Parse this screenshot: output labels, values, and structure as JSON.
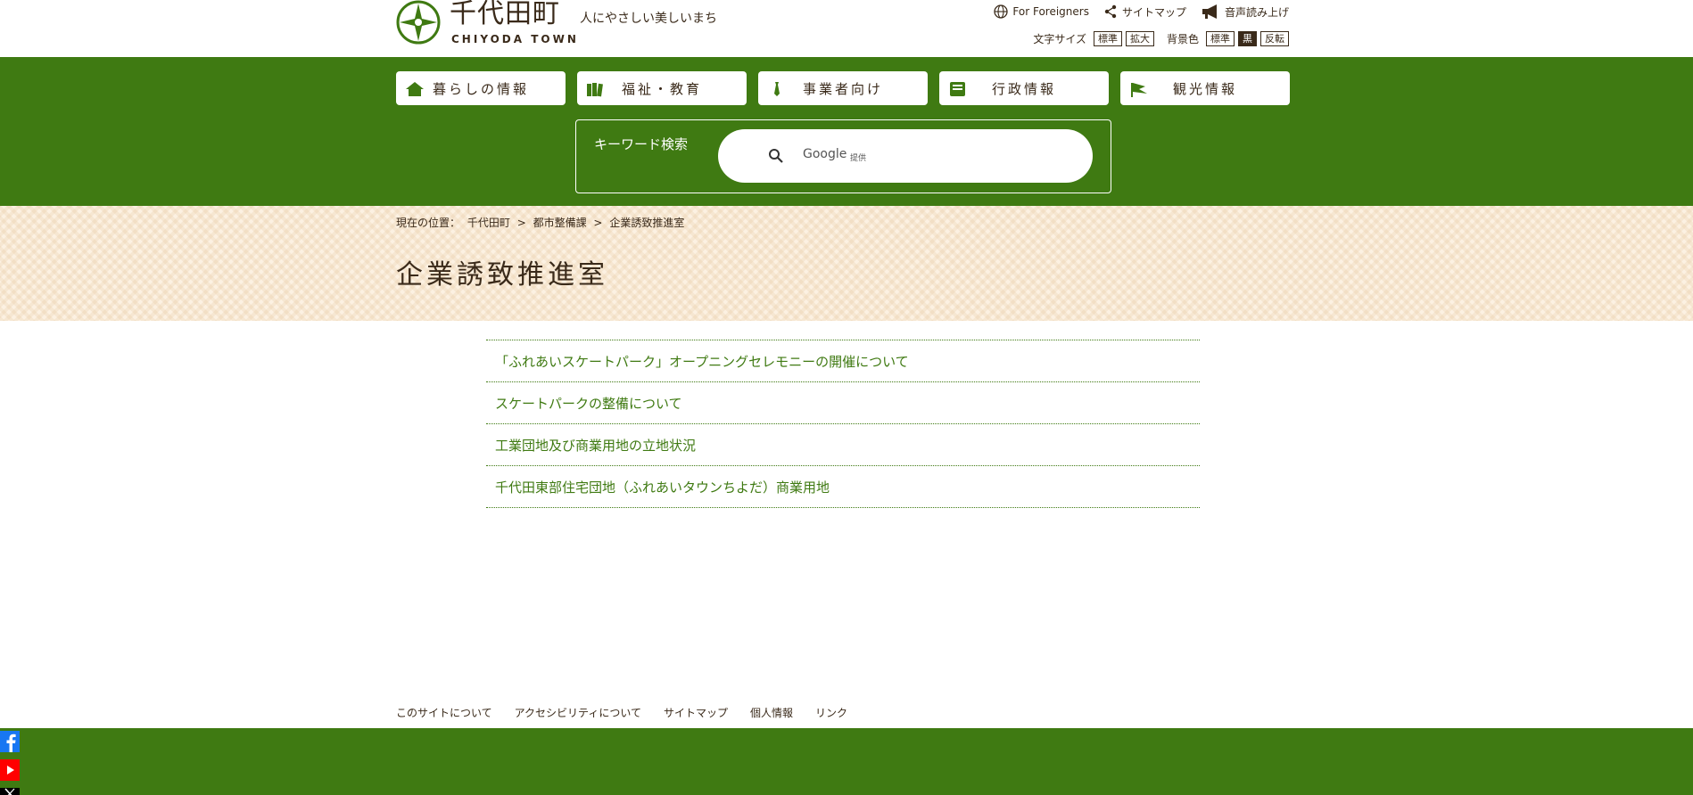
{
  "header": {
    "logo_jp": "千代田町",
    "logo_en": "CHIYODA TOWN",
    "tagline": "人にやさしい美しいまち",
    "links": [
      {
        "label": "For Foreigners",
        "icon": "globe-icon"
      },
      {
        "label": "サイトマップ",
        "icon": "share-icon"
      },
      {
        "label": "音声読み上げ",
        "icon": "megaphone-icon"
      }
    ],
    "font_size_label": "文字サイズ",
    "font_size_options": [
      "標準",
      "拡大"
    ],
    "bg_color_label": "背景色",
    "bg_color_options": [
      "標準",
      "黒",
      "反転"
    ]
  },
  "nav": [
    {
      "label": "暮らしの情報",
      "icon": "house-icon"
    },
    {
      "label": "福祉・教育",
      "icon": "books-icon"
    },
    {
      "label": "事業者向け",
      "icon": "necktie-icon"
    },
    {
      "label": "行政情報",
      "icon": "document-tray-icon"
    },
    {
      "label": "観光情報",
      "icon": "flag-icon"
    }
  ],
  "search": {
    "label": "キーワード検索",
    "provider": "Google",
    "provider_suffix": "提供"
  },
  "breadcrumb": {
    "prefix": "現在の位置：",
    "items": [
      "千代田町",
      "都市整備課",
      "企業誘致推進室"
    ],
    "separator": ">"
  },
  "page_title": "企業誘致推進室",
  "articles": [
    "「ふれあいスケートパーク」オープニングセレモニーの開催について",
    "スケートパークの整備について",
    "工業団地及び商業用地の立地状況",
    "千代田東部住宅団地（ふれあいタウンちよだ）商業用地"
  ],
  "footer_links": [
    "このサイトについて",
    "アクセシビリティについて",
    "サイトマップ",
    "個人情報",
    "リンク"
  ],
  "social": [
    "facebook-icon",
    "youtube-icon",
    "x-icon"
  ],
  "colors": {
    "brand_green": "#3f7a12",
    "text_brown": "#3a2a1a",
    "hero_bg": "#fcf1e2"
  }
}
